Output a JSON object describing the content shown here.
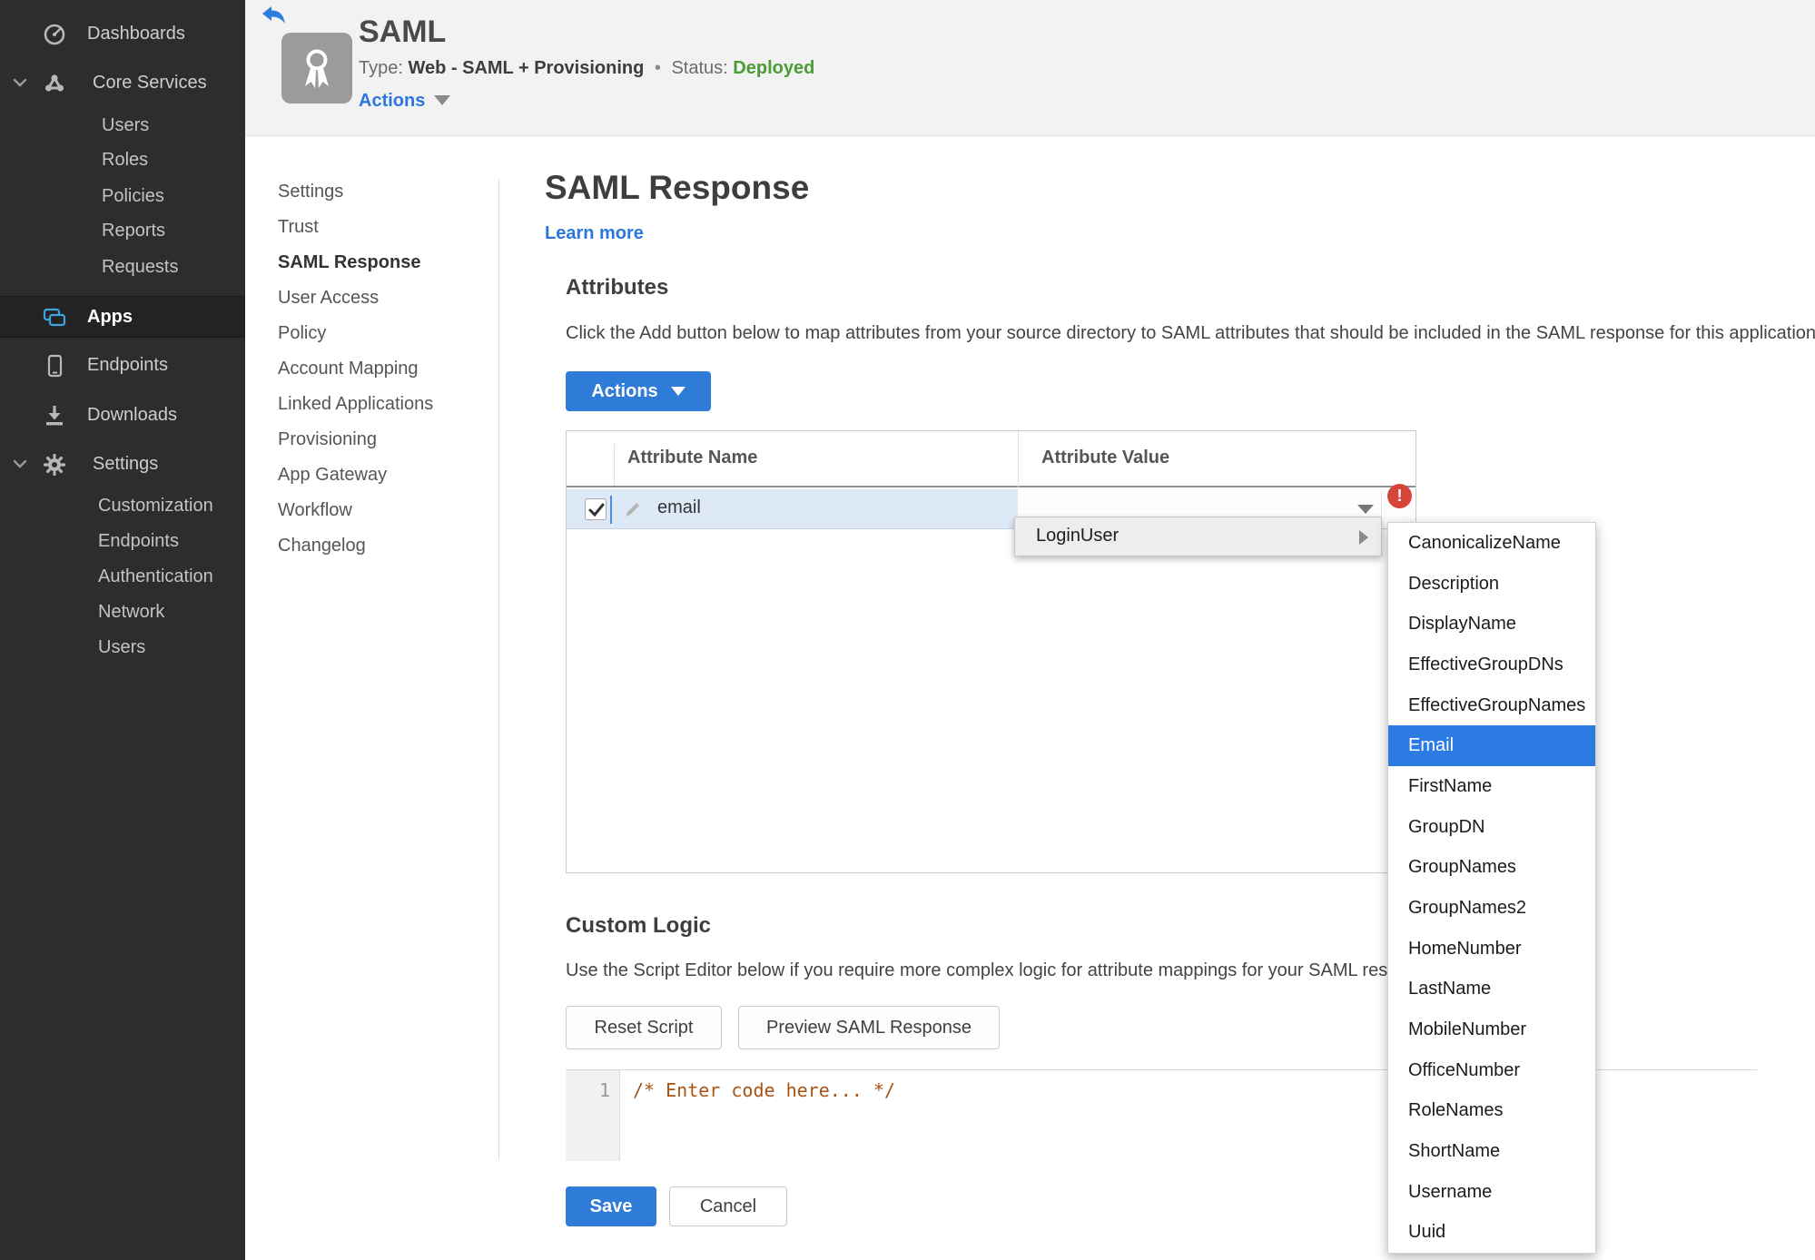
{
  "sidebar": {
    "items": [
      {
        "label": "Dashboards"
      },
      {
        "label": "Core Services"
      },
      {
        "label": "Users"
      },
      {
        "label": "Roles"
      },
      {
        "label": "Policies"
      },
      {
        "label": "Reports"
      },
      {
        "label": "Requests"
      },
      {
        "label": "Apps"
      },
      {
        "label": "Endpoints"
      },
      {
        "label": "Downloads"
      },
      {
        "label": "Settings"
      },
      {
        "label": "Customization"
      },
      {
        "label": "Endpoints"
      },
      {
        "label": "Authentication"
      },
      {
        "label": "Network"
      },
      {
        "label": "Users"
      }
    ]
  },
  "header": {
    "title": "SAML",
    "type_label": "Type:",
    "type_value": "Web - SAML + Provisioning",
    "separator": "•",
    "status_label": "Status:",
    "status_value": "Deployed",
    "actions_label": "Actions"
  },
  "subnav": {
    "items": [
      "Settings",
      "Trust",
      "SAML Response",
      "User Access",
      "Policy",
      "Account Mapping",
      "Linked Applications",
      "Provisioning",
      "App Gateway",
      "Workflow",
      "Changelog"
    ],
    "active": "SAML Response"
  },
  "main": {
    "title": "SAML Response",
    "learn_more": "Learn more",
    "attributes": {
      "heading": "Attributes",
      "description": "Click the Add button below to map attributes from your source directory to SAML attributes that should be included in the SAML response for this application.",
      "actions_button": "Actions",
      "table": {
        "col_name": "Attribute Name",
        "col_value": "Attribute Value",
        "row_name": "email",
        "row_checked": true,
        "error": "!"
      }
    },
    "dropdown": {
      "trigger": "LoginUser",
      "selected": "Email",
      "submenu": [
        "CanonicalizeName",
        "Description",
        "DisplayName",
        "EffectiveGroupDNs",
        "EffectiveGroupNames",
        "Email",
        "FirstName",
        "GroupDN",
        "GroupNames",
        "GroupNames2",
        "HomeNumber",
        "LastName",
        "MobileNumber",
        "OfficeNumber",
        "RoleNames",
        "ShortName",
        "Username",
        "Uuid"
      ]
    },
    "custom_logic": {
      "heading": "Custom Logic",
      "description": "Use the Script Editor below if you require more complex logic for attribute mappings for your SAML response.",
      "reset_button": "Reset Script",
      "preview_button": "Preview SAML Response",
      "line_number": "1",
      "code": "/* Enter code here... */"
    },
    "footer": {
      "save": "Save",
      "cancel": "Cancel"
    }
  },
  "colors": {
    "accent_blue": "#2f7cd8",
    "link_blue": "#2b77e0",
    "selection_blue": "#2c7be2",
    "status_green": "#4a9c35",
    "error_red": "#d6453a",
    "sidebar_bg": "#2d2d2d",
    "apps_icon_blue": "#3fa3e0"
  }
}
